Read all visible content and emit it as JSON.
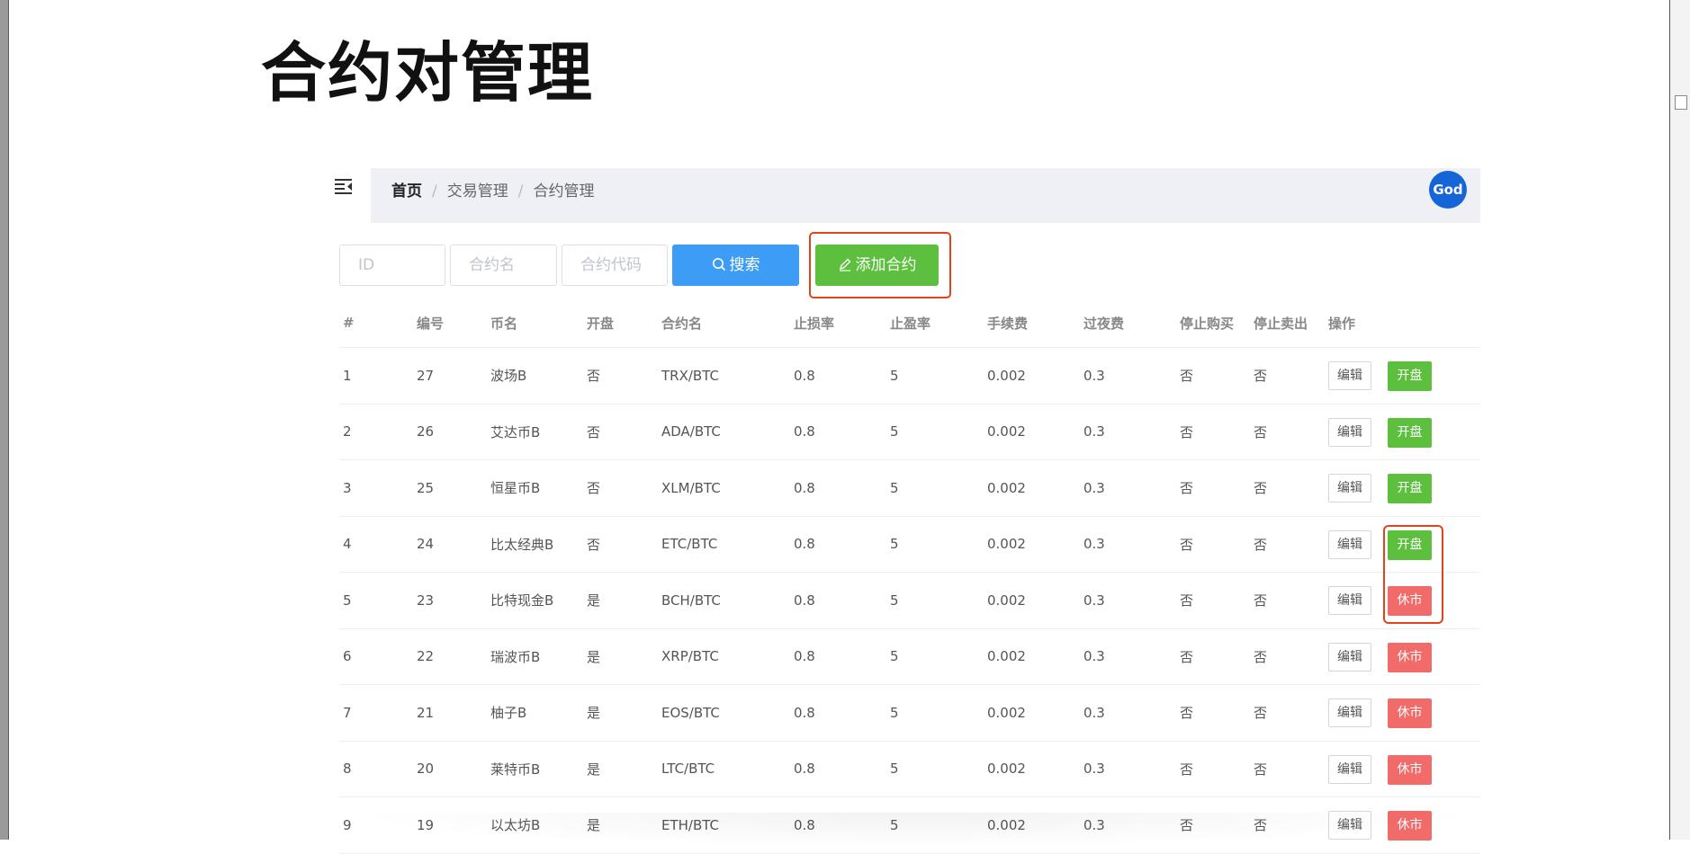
{
  "title": "合约对管理",
  "avatar_label": "God",
  "breadcrumb": [
    "首页",
    "交易管理",
    "合约管理"
  ],
  "search": {
    "id_placeholder": "ID",
    "name_placeholder": "合约名",
    "code_placeholder": "合约代码",
    "search_label": "搜索",
    "add_label": "添加合约"
  },
  "table": {
    "headers": [
      "#",
      "编号",
      "币名",
      "开盘",
      "合约名",
      "止损率",
      "止盈率",
      "手续费",
      "过夜费",
      "停止购买",
      "停止卖出",
      "操作"
    ],
    "edit_label": "编辑",
    "rows": [
      {
        "idx": "1",
        "id": "27",
        "coin": "波场B",
        "open": "否",
        "pair": "TRX/BTC",
        "stop_loss": "0.8",
        "take_profit": "5",
        "fee": "0.002",
        "overnight": "0.3",
        "stop_buy": "否",
        "stop_sell": "否",
        "action": "开盘",
        "status": "open"
      },
      {
        "idx": "2",
        "id": "26",
        "coin": "艾达币B",
        "open": "否",
        "pair": "ADA/BTC",
        "stop_loss": "0.8",
        "take_profit": "5",
        "fee": "0.002",
        "overnight": "0.3",
        "stop_buy": "否",
        "stop_sell": "否",
        "action": "开盘",
        "status": "open"
      },
      {
        "idx": "3",
        "id": "25",
        "coin": "恒星币B",
        "open": "否",
        "pair": "XLM/BTC",
        "stop_loss": "0.8",
        "take_profit": "5",
        "fee": "0.002",
        "overnight": "0.3",
        "stop_buy": "否",
        "stop_sell": "否",
        "action": "开盘",
        "status": "open"
      },
      {
        "idx": "4",
        "id": "24",
        "coin": "比太经典B",
        "open": "否",
        "pair": "ETC/BTC",
        "stop_loss": "0.8",
        "take_profit": "5",
        "fee": "0.002",
        "overnight": "0.3",
        "stop_buy": "否",
        "stop_sell": "否",
        "action": "开盘",
        "status": "open"
      },
      {
        "idx": "5",
        "id": "23",
        "coin": "比特现金B",
        "open": "是",
        "pair": "BCH/BTC",
        "stop_loss": "0.8",
        "take_profit": "5",
        "fee": "0.002",
        "overnight": "0.3",
        "stop_buy": "否",
        "stop_sell": "否",
        "action": "休市",
        "status": "closed"
      },
      {
        "idx": "6",
        "id": "22",
        "coin": "瑞波币B",
        "open": "是",
        "pair": "XRP/BTC",
        "stop_loss": "0.8",
        "take_profit": "5",
        "fee": "0.002",
        "overnight": "0.3",
        "stop_buy": "否",
        "stop_sell": "否",
        "action": "休市",
        "status": "closed"
      },
      {
        "idx": "7",
        "id": "21",
        "coin": "柚子B",
        "open": "是",
        "pair": "EOS/BTC",
        "stop_loss": "0.8",
        "take_profit": "5",
        "fee": "0.002",
        "overnight": "0.3",
        "stop_buy": "否",
        "stop_sell": "否",
        "action": "休市",
        "status": "closed"
      },
      {
        "idx": "8",
        "id": "20",
        "coin": "莱特币B",
        "open": "是",
        "pair": "LTC/BTC",
        "stop_loss": "0.8",
        "take_profit": "5",
        "fee": "0.002",
        "overnight": "0.3",
        "stop_buy": "否",
        "stop_sell": "否",
        "action": "休市",
        "status": "closed"
      },
      {
        "idx": "9",
        "id": "19",
        "coin": "以太坊B",
        "open": "是",
        "pair": "ETH/BTC",
        "stop_loss": "0.8",
        "take_profit": "5",
        "fee": "0.002",
        "overnight": "0.3",
        "stop_buy": "否",
        "stop_sell": "否",
        "action": "休市",
        "status": "closed"
      }
    ]
  },
  "colors": {
    "search_button": "#3d9cf5",
    "open_button": "#5cbf3e",
    "closed_button": "#f26b6b",
    "highlight": "#e4421a",
    "avatar": "#1565d8"
  },
  "icons": [
    "menu-fold-icon",
    "search-icon",
    "edit-pen-icon"
  ]
}
